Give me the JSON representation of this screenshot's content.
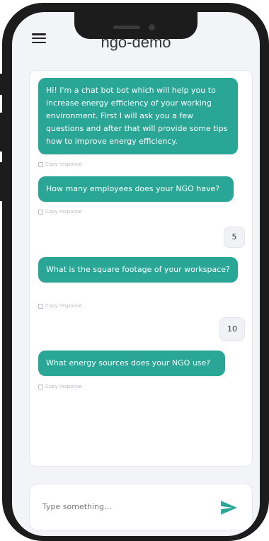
{
  "app": {
    "title": "ngo-demo"
  },
  "messages": [
    {
      "from": "bot",
      "text": "Hi! I'm a chat bot bot which will help you to increase energy efficiency of your working environment. First I will ask you a few questions and after that will provide some tips how to improve energy efficiency.",
      "copy_label": "Copy response"
    },
    {
      "from": "bot",
      "text": "How many employees does your NGO have?",
      "copy_label": "Copy response"
    },
    {
      "from": "user",
      "text": "5"
    },
    {
      "from": "bot",
      "text": "What is the square footage of your workspace?",
      "copy_label": "Copy response"
    },
    {
      "from": "user",
      "text": "10"
    },
    {
      "from": "bot",
      "text": "What energy sources does your NGO use?",
      "copy_label": "Copy response"
    }
  ],
  "input": {
    "placeholder": "Type something..."
  },
  "colors": {
    "accent": "#2aa697",
    "background": "#f3f4f8",
    "phone_frame": "#1c1c1c"
  },
  "icons": {
    "menu": "hamburger-menu-icon",
    "send": "send-icon",
    "copy": "copy-icon"
  }
}
